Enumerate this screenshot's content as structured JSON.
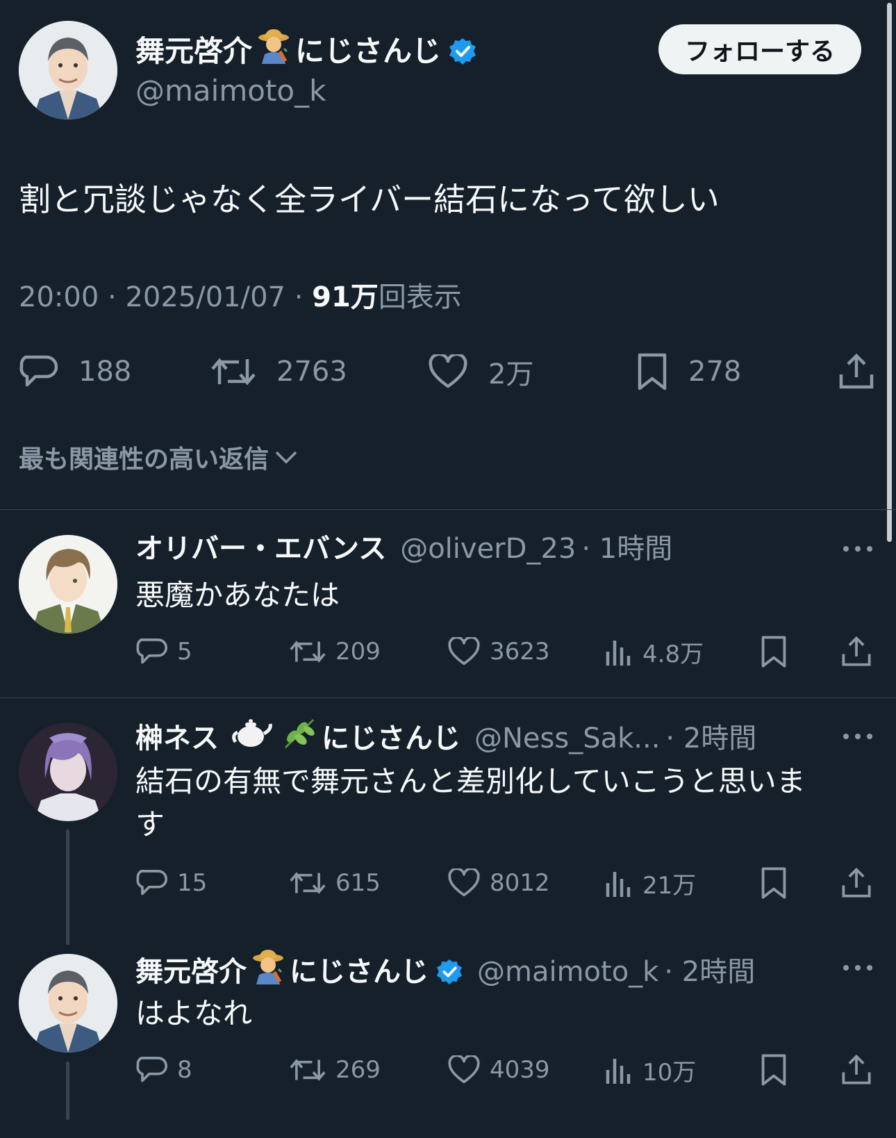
{
  "main_tweet": {
    "display_name": "舞元啓介",
    "display_name_suffix": "にじさんじ",
    "handle": "@maimoto_k",
    "follow_label": "フォローする",
    "text": "割と冗談じゃなく全ライバー結石になって欲しい",
    "time": "20:00",
    "sep1": " · ",
    "date": "2025/01/07",
    "sep2": " · ",
    "views_num": "91万",
    "views_label": "回表示",
    "replies": "188",
    "retweets": "2763",
    "likes": "2万",
    "bookmarks": "278"
  },
  "reply_sort_label": "最も関連性の高い返信",
  "replies": [
    {
      "display_name": "オリバー・エバンス",
      "handle": "@oliverD_23",
      "time": "· 1時間",
      "text": "悪魔かあなたは",
      "replies": "5",
      "retweets": "209",
      "likes": "3623",
      "views": "4.8万"
    },
    {
      "display_name": "榊ネス",
      "display_name_suffix": "にじさんじ",
      "handle": "@Ness_Sak...",
      "time": "· 2時間",
      "text_line1": "結石の有無で舞元さんと差別化していこうと思いま",
      "text_line2": "す",
      "replies": "15",
      "retweets": "615",
      "likes": "8012",
      "views": "21万"
    },
    {
      "display_name": "舞元啓介",
      "display_name_suffix": "にじさんじ",
      "handle": "@maimoto_k",
      "time": "· 2時間",
      "text": "はよなれ",
      "replies": "8",
      "retweets": "269",
      "likes": "4039",
      "views": "10万"
    }
  ],
  "icons": {
    "reply": "speech-bubble-icon",
    "retweet": "retweet-icon",
    "like": "heart-icon",
    "bookmark": "bookmark-icon",
    "share": "share-icon",
    "views": "bar-chart-icon",
    "more": "more-dots-icon",
    "verified": "verified-badge-icon",
    "chevron": "chevron-down-icon"
  },
  "colors": {
    "background": "#15202b",
    "text": "#f7f9f9",
    "muted": "#8b98a5",
    "verified": "#1d9bf0",
    "divider": "#38444d"
  }
}
